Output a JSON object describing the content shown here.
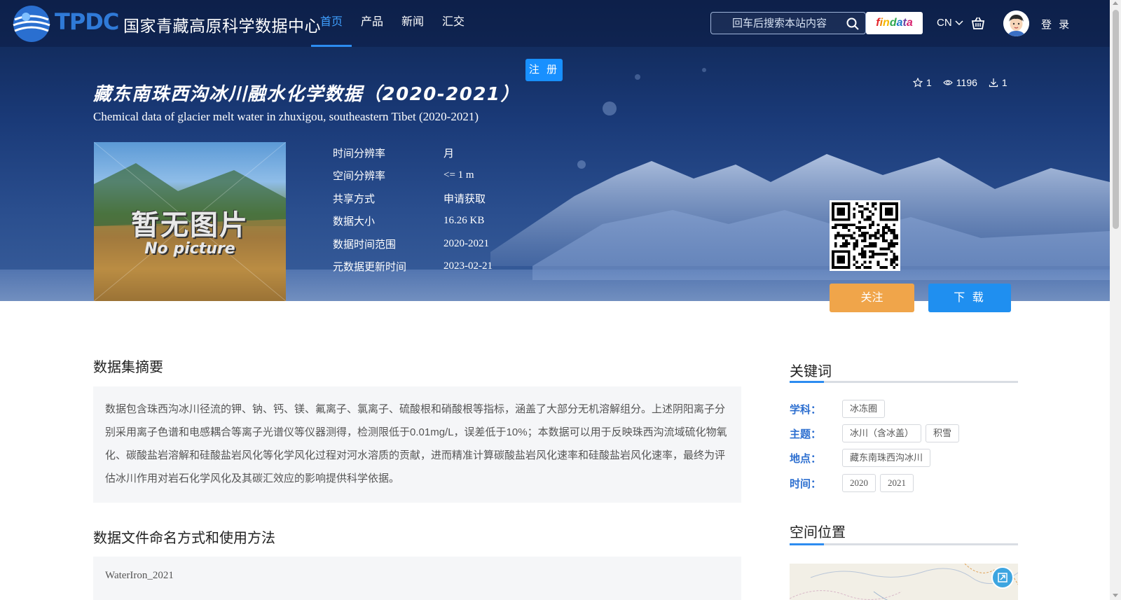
{
  "nav": {
    "logo_text": "TPDC",
    "logo_cn": "国家青藏高原科学数据中心",
    "menu": [
      {
        "label": "首页"
      },
      {
        "label": "产品"
      },
      {
        "label": "新闻"
      },
      {
        "label": "汇交"
      }
    ],
    "search_placeholder": "回车后搜索本站内容",
    "findata_letters": [
      "f",
      "i",
      "n",
      "d",
      "a",
      "t",
      "a"
    ],
    "lang": "CN",
    "login": "登 录"
  },
  "hero": {
    "register_label": "注 册",
    "title_cn": "藏东南珠西沟冰川融水化学数据（2020-2021）",
    "title_en": "Chemical data of glacier melt water in zhuxigou, southeastern Tibet (2020-2021)",
    "stats": {
      "stars": "1",
      "views": "1196",
      "downloads": "1"
    },
    "thumbnail": {
      "label_cn": "暂无图片",
      "label_en": "No picture"
    },
    "meta": [
      {
        "key": "时间分辨率",
        "value": "月"
      },
      {
        "key": "空间分辨率",
        "value": "<= 1 m"
      },
      {
        "key": "共享方式",
        "value": "申请获取"
      },
      {
        "key": "数据大小",
        "value": "16.26 KB"
      },
      {
        "key": "数据时间范围",
        "value": "2020-2021"
      },
      {
        "key": "元数据更新时间",
        "value": "2023-02-21"
      }
    ],
    "follow_label": "关注",
    "download_label": "下 载"
  },
  "abstract": {
    "title": "数据集摘要",
    "text": "数据包含珠西沟冰川径流的钾、钠、钙、镁、氟离子、氯离子、硫酸根和硝酸根等指标，涵盖了大部分无机溶解组分。上述阴阳离子分别采用离子色谱和电感耦合等离子光谱仪等仪器测得，检测限低于0.01mg/L，误差低于10%；本数据可以用于反映珠西沟流域硫化物氧化、碳酸盐岩溶解和硅酸盐岩风化等化学风化过程对河水溶质的贡献，进而精准计算碳酸盐岩风化速率和硅酸盐岩风化速率，最终为评估冰川作用对岩石化学风化及其碳汇效应的影响提供科学依据。"
  },
  "file_naming": {
    "title": "数据文件命名方式和使用方法",
    "text": "WaterIron_2021"
  },
  "keywords": {
    "title": "关键词",
    "rows": [
      {
        "label": "学科：",
        "tags": [
          "冰冻圈"
        ]
      },
      {
        "label": "主题：",
        "tags": [
          "冰川（含冰盖）",
          "积雪"
        ]
      },
      {
        "label": "地点：",
        "tags": [
          "藏东南珠西沟冰川"
        ]
      },
      {
        "label": "时间：",
        "tags": [
          "2020",
          "2021"
        ]
      }
    ]
  },
  "location": {
    "title": "空间位置"
  },
  "colors": {
    "accent": "#2d8cf0",
    "follow": "#f0a54a",
    "download": "#1f8ff0",
    "nav_bg": "#0c1e46"
  }
}
